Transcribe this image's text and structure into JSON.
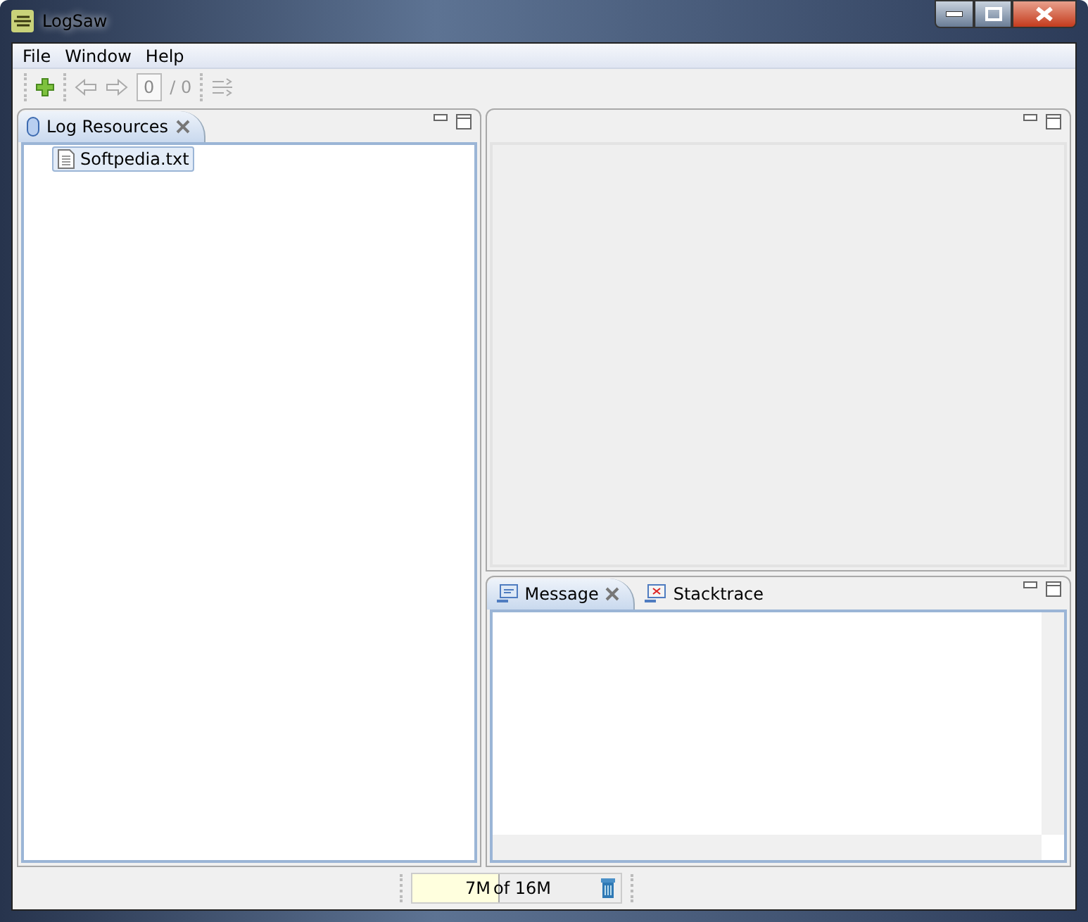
{
  "window": {
    "title": "LogSaw"
  },
  "menu": [
    "File",
    "Window",
    "Help"
  ],
  "toolbar": {
    "page_value": "0",
    "page_total": "/ 0"
  },
  "left_pane": {
    "tabs": [
      {
        "label": "Log Resources",
        "selected": true
      }
    ],
    "tree": [
      {
        "label": "Softpedia.txt",
        "selected": true
      }
    ]
  },
  "bottom_pane": {
    "tabs": [
      {
        "label": "Message",
        "selected": true
      },
      {
        "label": "Stacktrace",
        "selected": false
      }
    ]
  },
  "status_bar": {
    "used": "7M",
    "total": "of 16M",
    "level": 0.42
  }
}
